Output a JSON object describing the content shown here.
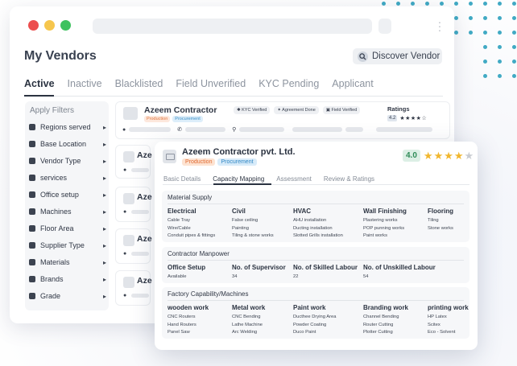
{
  "window": {
    "page_title": "My Vendors",
    "discover_label": "Discover Vendor",
    "tabs": [
      "Active",
      "Inactive",
      "Blacklisted",
      "Field Unverified",
      "KYC Pending",
      "Applicant"
    ],
    "active_tab": "Active"
  },
  "filters": {
    "title": "Apply Filters",
    "items": [
      {
        "label": "Regions served",
        "icon": "map-pins-icon"
      },
      {
        "label": "Base Location",
        "icon": "location-pin-icon"
      },
      {
        "label": "Vendor Type",
        "icon": "tag-icon"
      },
      {
        "label": "services",
        "icon": "tools-icon"
      },
      {
        "label": "Office setup",
        "icon": "office-icon"
      },
      {
        "label": "Machines",
        "icon": "machine-icon"
      },
      {
        "label": "Floor Area",
        "icon": "floor-area-icon"
      },
      {
        "label": "Supplier Type",
        "icon": "supplier-icon"
      },
      {
        "label": "Materials",
        "icon": "materials-icon"
      },
      {
        "label": "Brands",
        "icon": "brand-tag-icon"
      },
      {
        "label": "Grade",
        "icon": "grade-icon"
      }
    ]
  },
  "vendor_list": {
    "first": {
      "name": "Azeem Contractor",
      "badges": [
        "Production",
        "Procurement"
      ],
      "kyc_badges": [
        "KYC Verified",
        "Agreement Done",
        "Field Verified"
      ],
      "ratings_label": "Ratings",
      "rating": "4.2",
      "stars": "★★★★☆"
    },
    "stub_name": "Aze"
  },
  "detail": {
    "name": "Azeem Contractor pvt. Ltd.",
    "badges": [
      "Production",
      "Procurement"
    ],
    "rating": "4.0",
    "stars_filled": 4,
    "stars_total": 5,
    "tabs": [
      "Basic Details",
      "Capacity Mapping",
      "Assessment",
      "Review & Ratings"
    ],
    "active_tab": "Capacity Mapping",
    "material_supply": {
      "title": "Material Supply",
      "columns": [
        {
          "heading": "Electrical",
          "items": [
            "Cable Tray",
            "Wire/Cable",
            "Conduit pipes & fittings"
          ]
        },
        {
          "heading": "Civil",
          "items": [
            "False ceiling",
            "Painting",
            "Tiling & stone works"
          ]
        },
        {
          "heading": "HVAC",
          "items": [
            "AHU installation",
            "Ducting installation",
            "Slotted Grills installation"
          ]
        },
        {
          "heading": "Wall Finishing",
          "items": [
            "Plastering works",
            "POP punning works",
            "Paint works"
          ]
        },
        {
          "heading": "Flooring",
          "items": [
            "Tiling",
            "Stone works"
          ]
        }
      ]
    },
    "manpower": {
      "title": "Contractor Manpower",
      "columns": [
        {
          "heading": "Office Setup",
          "items": [
            "Available"
          ]
        },
        {
          "heading": "No. of Supervisor",
          "items": [
            "34"
          ]
        },
        {
          "heading": "No. of Skilled Labour",
          "items": [
            "22"
          ]
        },
        {
          "heading": "No. of Unskilled Labour",
          "items": [
            "54"
          ]
        }
      ]
    },
    "factory": {
      "title": "Factory Capability/Machines",
      "columns": [
        {
          "heading": "wooden work",
          "items": [
            "CNC Routers",
            "Hand Routers",
            "Panel Saw"
          ]
        },
        {
          "heading": "Metal work",
          "items": [
            "CNC Bending",
            "Lathe Machine",
            "Arc Welding"
          ]
        },
        {
          "heading": "Paint work",
          "items": [
            "Ducthee Drying Area",
            "Powder Coating",
            "Duco Paint"
          ]
        },
        {
          "heading": "Branding work",
          "items": [
            "Channel Bending",
            "Router Cutting",
            "Plotter Cutting"
          ]
        },
        {
          "heading": "printing work",
          "items": [
            "HP Latex",
            "Scitex",
            "Eco - Solvent"
          ]
        }
      ]
    }
  },
  "colors": {
    "accent_orange": "#e0692f",
    "accent_blue": "#2f87c4",
    "rating_green": "#2e8b57",
    "star_gold": "#f1b72f",
    "dot_teal": "#41aac4"
  }
}
